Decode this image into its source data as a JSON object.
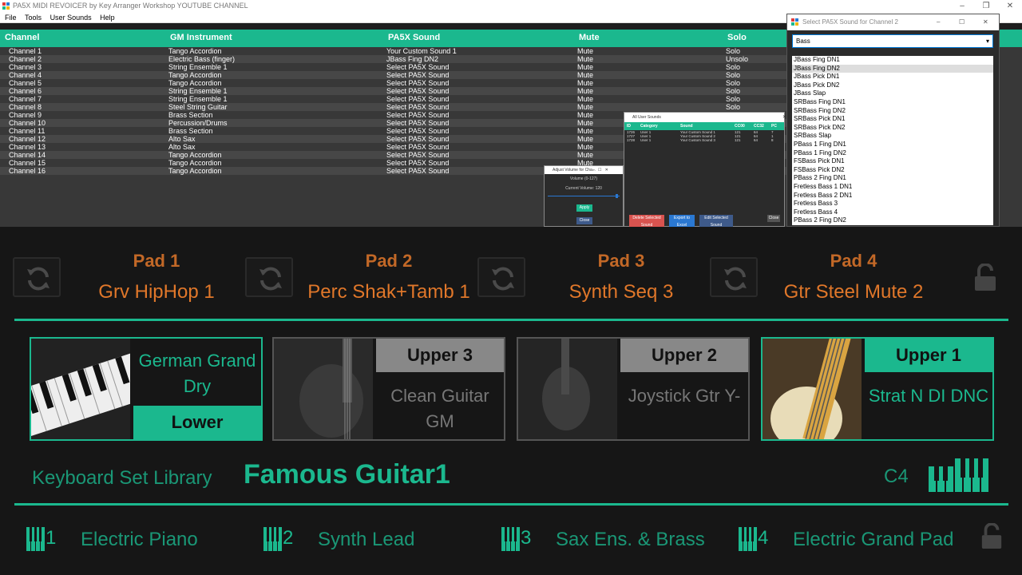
{
  "window": {
    "title": "PA5X MIDI REVOICER by Key Arranger Workshop YOUTUBE CHANNEL"
  },
  "menu": [
    "File",
    "Tools",
    "User Sounds",
    "Help"
  ],
  "grid": {
    "headers": [
      "Channel",
      "GM Instrument",
      "PA5X Sound",
      "Mute",
      "Solo"
    ],
    "rows": [
      [
        "Channel 1",
        "Tango Accordion",
        "Your Custom Sound 1",
        "Mute",
        "Solo"
      ],
      [
        "Channel 2",
        "Electric Bass (finger)",
        "JBass Fing DN2",
        "Mute",
        "Unsolo"
      ],
      [
        "Channel 3",
        "String Ensemble 1",
        "Select PA5X Sound",
        "Mute",
        "Solo"
      ],
      [
        "Channel 4",
        "Tango Accordion",
        "Select PA5X Sound",
        "Mute",
        "Solo"
      ],
      [
        "Channel 5",
        "Tango Accordion",
        "Select PA5X Sound",
        "Mute",
        "Solo"
      ],
      [
        "Channel 6",
        "String Ensemble 1",
        "Select PA5X Sound",
        "Mute",
        "Solo"
      ],
      [
        "Channel 7",
        "String Ensemble 1",
        "Select PA5X Sound",
        "Mute",
        "Solo"
      ],
      [
        "Channel 8",
        "Steel String Guitar",
        "Select PA5X Sound",
        "Mute",
        "Solo"
      ],
      [
        "Channel 9",
        "Brass Section",
        "Select PA5X Sound",
        "Mute",
        "Solo"
      ],
      [
        "Channel 10",
        "Percussion/Drums",
        "Select PA5X Sound",
        "Mute",
        "Solo"
      ],
      [
        "Channel 11",
        "Brass Section",
        "Select PA5X Sound",
        "Mute",
        "Solo"
      ],
      [
        "Channel 12",
        "Alto Sax",
        "Select PA5X Sound",
        "Mute",
        "Solo"
      ],
      [
        "Channel 13",
        "Alto Sax",
        "Select PA5X Sound",
        "Mute",
        "Solo"
      ],
      [
        "Channel 14",
        "Tango Accordion",
        "Select PA5X Sound",
        "Mute",
        "Solo"
      ],
      [
        "Channel 15",
        "Tango Accordion",
        "Select PA5X Sound",
        "Mute",
        "Solo"
      ],
      [
        "Channel 16",
        "Tango Accordion",
        "Select PA5X Sound",
        "Mute",
        "Solo"
      ]
    ]
  },
  "volume_dialog": {
    "title": "Adjust Volume for Cha...",
    "range_label": "Volume (0-127)",
    "current_label": "Current Volume: 120",
    "slider_value": 120,
    "apply": "Apply",
    "close": "Close"
  },
  "user_sounds": {
    "title": "All User Sounds",
    "headers": [
      "ID",
      "Category",
      "Sound",
      "CC00",
      "CC32",
      "PC"
    ],
    "rows": [
      [
        "1726",
        "User 1",
        "Your Custom Sound 1",
        "121",
        "64",
        "7"
      ],
      [
        "1727",
        "User 1",
        "Your Custom Sound 2",
        "121",
        "64",
        "1"
      ],
      [
        "1728",
        "User 1",
        "Your Custom Sound 3",
        "121",
        "64",
        "8"
      ]
    ],
    "delete": "Delete Selected Sound",
    "export": "Export to Excel",
    "edit": "Edit Selected Sound",
    "close": "Close"
  },
  "select_dialog": {
    "title": "Select PA5X Sound for Channel 2",
    "filter": "Bass",
    "selected": "JBass Fing DN2",
    "items": [
      "JBass Fing DN1",
      "JBass Fing DN2",
      "JBass Pick DN1",
      "JBass Pick DN2",
      "JBass Slap",
      "SRBass Fing DN1",
      "SRBass Fing DN2",
      "SRBass Pick DN1",
      "SRBass Pick DN2",
      "SRBass Slap",
      "PBass 1 Fing DN1",
      "PBass 1 Fing DN2",
      "FSBass Pick DN1",
      "FSBass Pick DN2",
      "PBass 2 Fing DN1",
      "Fretless Bass 1 DN1",
      "Fretless Bass 2 DN1",
      "Fretless Bass 3",
      "Fretless Bass 4",
      "PBass 2 Fing DN2"
    ]
  },
  "pads": [
    {
      "label": "Pad 1",
      "sound": "Grv HipHop 1"
    },
    {
      "label": "Pad 2",
      "sound": "Perc Shak+Tamb 1"
    },
    {
      "label": "Pad 3",
      "sound": "Synth Seq 3"
    },
    {
      "label": "Pad 4",
      "sound": "Gtr Steel Mute 2"
    }
  ],
  "keyboards": [
    {
      "header": "Lower",
      "name": "German Grand Dry",
      "active": true
    },
    {
      "header": "Upper 3",
      "name": "Clean Guitar GM",
      "active": false
    },
    {
      "header": "Upper 2",
      "name": "Joystick Gtr Y-",
      "active": false
    },
    {
      "header": "Upper 1",
      "name": "Strat N DI DNC",
      "active": true
    }
  ],
  "library": {
    "label": "Keyboard Set Library",
    "name": "Famous Guitar1",
    "split_point": "C4"
  },
  "keyboard_sets": [
    {
      "num": "1",
      "name": "Electric Piano"
    },
    {
      "num": "2",
      "name": "Synth Lead"
    },
    {
      "num": "3",
      "name": "Sax Ens. & Brass"
    },
    {
      "num": "4",
      "name": "Electric Grand Pad"
    }
  ],
  "colors": {
    "accent": "#1bb88e",
    "pad_text": "#e0772a"
  }
}
